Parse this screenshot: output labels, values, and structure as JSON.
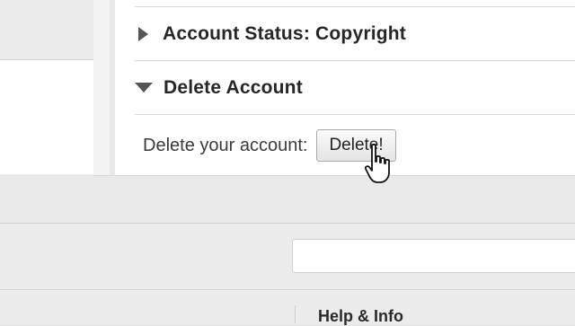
{
  "sections": [
    {
      "title": "Account Status: Copyright",
      "state": "collapsed"
    },
    {
      "title": "Delete Account",
      "state": "expanded"
    }
  ],
  "delete": {
    "label": "Delete your account:",
    "button_label": "Delete!"
  },
  "search": {
    "value": "",
    "placeholder": ""
  },
  "footer": {
    "help_label": "Help & Info"
  },
  "icons": {
    "collapsed": "triangle-right-icon",
    "expanded": "triangle-down-icon",
    "cursor": "hand-pointer-icon"
  }
}
